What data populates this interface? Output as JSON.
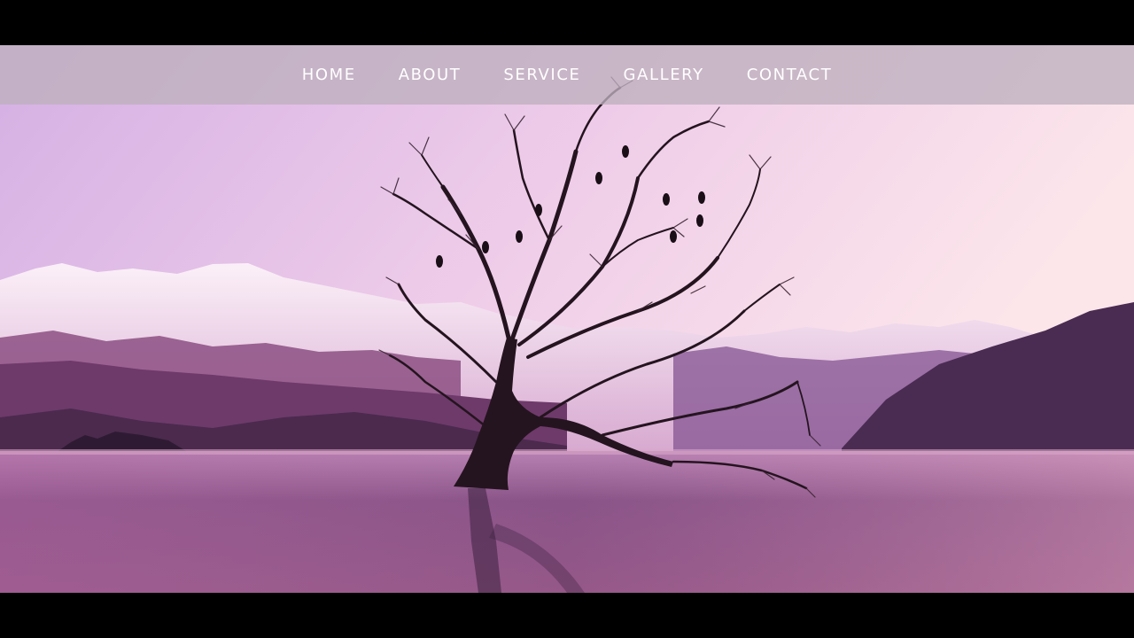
{
  "nav": {
    "items": [
      {
        "label": "HOME"
      },
      {
        "label": "ABOUT"
      },
      {
        "label": "SERVICE"
      },
      {
        "label": "GALLERY"
      },
      {
        "label": "CONTACT"
      }
    ]
  },
  "colors": {
    "sky_top": "#d9b9e6",
    "sky_horizon": "#fbe3ea",
    "water": "#6a3f73",
    "navbar": "#beb0be",
    "letterbox": "#000000"
  }
}
